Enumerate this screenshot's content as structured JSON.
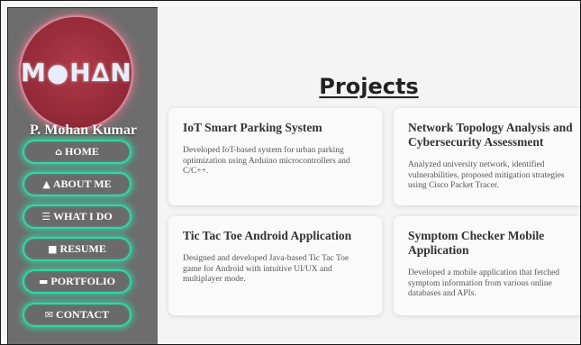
{
  "sidebar": {
    "logo_text": "M●H∆N",
    "name": "P. Mohan Kumar",
    "items": [
      {
        "icon": "home-icon",
        "glyph": "⌂",
        "label": "HOME"
      },
      {
        "icon": "user-icon",
        "glyph": "▲",
        "label": "ABOUT ME"
      },
      {
        "icon": "list-icon",
        "glyph": "☰",
        "label": "WHAT I DO"
      },
      {
        "icon": "file-icon",
        "glyph": "■",
        "label": "RESUME"
      },
      {
        "icon": "folder-icon",
        "glyph": "▬",
        "label": "PORTFOLIO"
      },
      {
        "icon": "envelope-icon",
        "glyph": "✉",
        "label": "CONTACT"
      }
    ],
    "accent_color": "#33d6a0"
  },
  "main": {
    "title": "Projects",
    "projects": [
      {
        "title": "IoT Smart Parking System",
        "description": "Developed IoT-based system for urban parking optimization using Arduino microcontrollers and C/C++."
      },
      {
        "title": "Network Topology Analysis and Cybersecurity Assessment",
        "description": "Analyzed university network, identified vulnerabilities, proposed mitigation strategies using Cisco Packet Tracer."
      },
      {
        "title": "Tic Tac Toe Android Application",
        "description": "Designed and developed Java-based Tic Tac Toe game for Android with intuitive UI/UX and multiplayer mode."
      },
      {
        "title": "Symptom Checker Mobile Application",
        "description": "Developed a mobile application that fetched symptom information from various online databases and APIs."
      }
    ]
  }
}
